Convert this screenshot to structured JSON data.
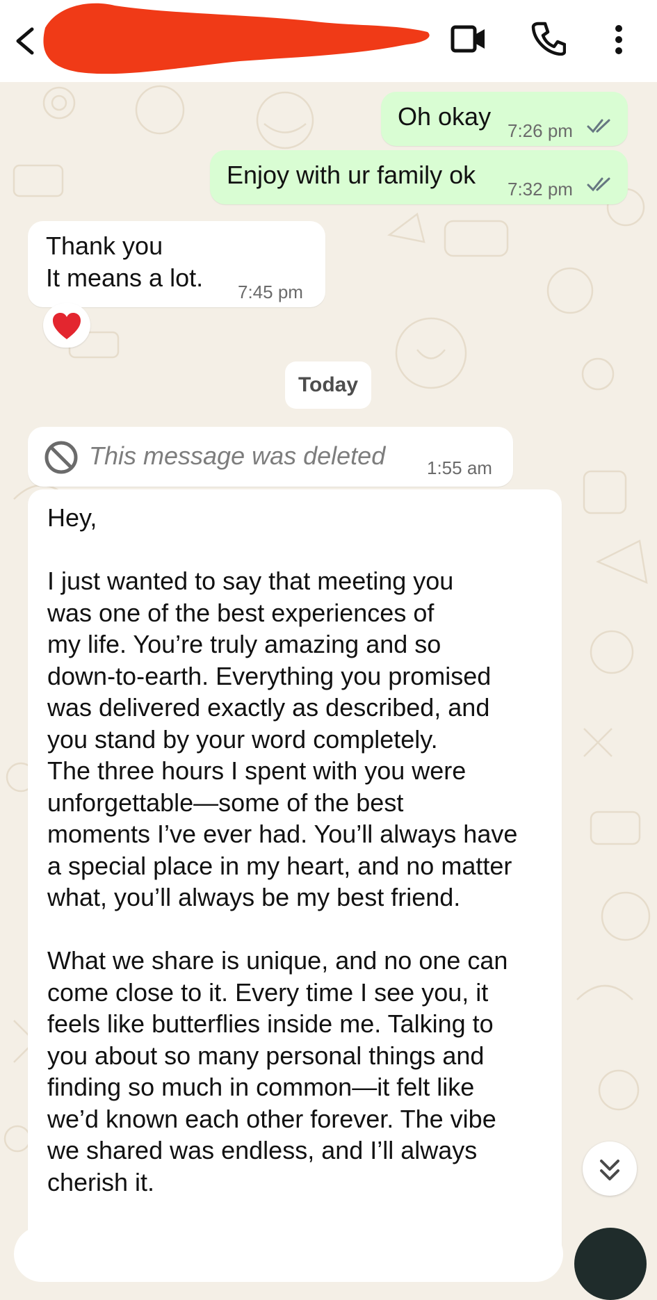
{
  "header": {
    "contact_name": "",
    "icons": [
      "back-arrow-icon",
      "video-call-icon",
      "phone-icon",
      "more-vert-icon"
    ]
  },
  "messages": [
    {
      "direction": "outgoing",
      "text": "Oh okay",
      "time": "7:26 pm",
      "status": "read"
    },
    {
      "direction": "outgoing",
      "text": "Enjoy with ur family ok",
      "time": "7:32 pm",
      "status": "read"
    },
    {
      "direction": "incoming",
      "text_line1": "Thank you",
      "text_line2": "It means a lot.",
      "time": "7:45 pm",
      "reaction": "❤️"
    }
  ],
  "date_divider": "Today",
  "deleted_message": {
    "text": "This message was deleted",
    "time": "1:55 am"
  },
  "long_message": {
    "text": "Hey,\n\nI just wanted to say that meeting you\nwas one of the best experiences of\nmy life. You’re truly amazing and so\ndown-to-earth. Everything you promised\nwas delivered exactly as described, and\nyou stand by your word completely.\nThe three hours I spent with you were\nunforgettable—some of the best\nmoments I’ve ever had. You’ll always have\na special place in my heart, and no matter\nwhat, you’ll always be my best friend.\n\nWhat we share is unique, and no one can\ncome close to it. Every time I see you, it\nfeels like butterflies inside me. Talking to\nyou about so many personal things and\nfinding so much in common—it felt like\nwe’d known each other forever. The vibe\nwe shared was endless, and I’ll always\ncherish it."
  },
  "colors": {
    "outgoing_bubble": "#d9fdd3",
    "incoming_bubble": "#ffffff",
    "chat_background": "#f4efe6",
    "read_ticks": "#667781",
    "redaction": "#f03a17"
  }
}
